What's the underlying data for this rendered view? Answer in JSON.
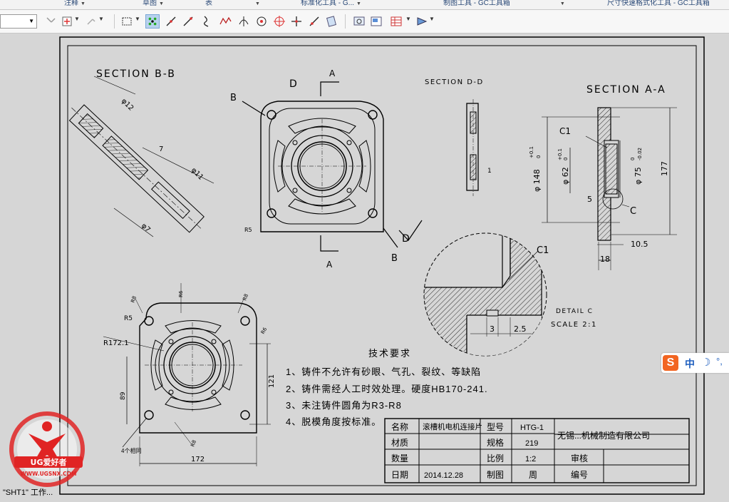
{
  "ribbon": {
    "groups": [
      {
        "label": "注释"
      },
      {
        "label": "草图"
      },
      {
        "label": "表"
      },
      {
        "label": "标准化工具 - G..."
      },
      {
        "label": "制图工具 - GC工具箱"
      },
      {
        "label": "尺寸快速格式化工具 - GC工具箱"
      }
    ]
  },
  "toolbar": {
    "icons": [
      "filter-icon",
      "snap-point-icon",
      "find-icon",
      "select-box-icon",
      "snap-grid-icon",
      "line-icon",
      "line-alt-icon",
      "curve-icon",
      "spline-icon",
      "tangent-icon",
      "center-icon",
      "quadrant-icon",
      "intersection-icon",
      "point-on-curve-icon",
      "clipboard-icon",
      "view-icon",
      "sheet-icon",
      "table-icon",
      "arrow-tool-icon"
    ]
  },
  "drawing": {
    "section_bb": "SECTION  B-B",
    "section_dd": "SECTION  D-D",
    "section_aa": "SECTION  A-A",
    "detail_c": "DETAIL  C",
    "scale": "SCALE  2:1",
    "labels": {
      "A_top": "A",
      "A_bottom": "A",
      "B_left": "B",
      "B_bottom": "B",
      "D_top": "D",
      "D_bottom": "D",
      "C_label": "C",
      "C1_top": "C1",
      "C1_detail": "C1",
      "C_sec": "C"
    },
    "dims": {
      "phi12": "φ12",
      "d7": "7",
      "d1": "1",
      "phi11": "φ11",
      "phi7": "φ7",
      "r172": "R172.1",
      "d148": "φ 148",
      "d148_tol": "+0.1",
      "d148_tol2": "0",
      "d62": "φ 62",
      "d62_tol": "+0.1",
      "d62_tol2": "0",
      "d75": "φ 75",
      "d75_tol": "0",
      "d75_tol2": "-0.02",
      "d177": "177",
      "d5": "5",
      "d105": "10.5",
      "d18": "18",
      "d3": "3",
      "d25": "2.5",
      "d121": "121",
      "d89": "89",
      "d172": "172",
      "d4hole": "4个相同",
      "r5": "R5",
      "r8": "R8",
      "r6": "R6"
    },
    "tech_title": "技术要求",
    "tech_notes": [
      "1、铸件不允许有砂眼、气孔、裂纹、等缺陷",
      "2、铸件需经人工时效处理。硬度HB170-241.",
      "3、未注铸件圆角为R3-R8",
      "4、脱模角度按标准。"
    ],
    "title_block": {
      "name_label": "名称",
      "name_value": "滚槽机电机连接片",
      "model_label": "型号",
      "model_value": "HTG-1",
      "material_label": "材质",
      "spec_label": "规格",
      "spec_value": "219",
      "company": "无锡...机械制造有限公司",
      "qty_label": "数量",
      "ratio_label": "比例",
      "ratio_value": "1:2",
      "review_label": "审核",
      "date_label": "日期",
      "date_value": "2014.12.28",
      "draw_label": "制图",
      "drawer": "周",
      "number_label": "编号"
    }
  },
  "ime": {
    "s": "S",
    "zh": "中",
    "moon": "☽",
    "punct": "°,"
  },
  "sheet_tab": "\"SHT1\" 工作...",
  "watermark": {
    "brand": "UG爱好者",
    "url": "WWW.UGSNX.COM"
  }
}
